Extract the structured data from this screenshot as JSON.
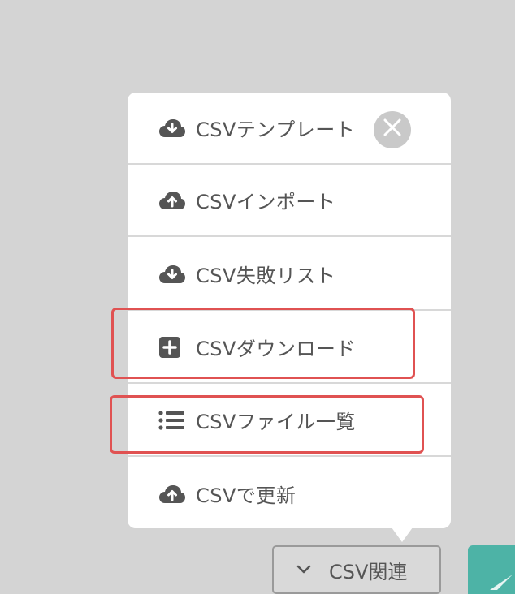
{
  "menu": {
    "items": [
      {
        "label": "CSVテンプレート",
        "icon": "cloud-download-icon"
      },
      {
        "label": "CSVインポート",
        "icon": "cloud-upload-icon"
      },
      {
        "label": "CSV失敗リスト",
        "icon": "cloud-download-icon"
      },
      {
        "label": "CSVダウンロード",
        "icon": "plus-square-icon"
      },
      {
        "label": "CSVファイル一覧",
        "icon": "list-icon"
      },
      {
        "label": "CSVで更新",
        "icon": "cloud-upload-icon"
      }
    ],
    "close_icon": "close-icon"
  },
  "toolbar": {
    "csv_button_label": "CSV関連",
    "csv_button_icon": "chevron-down-icon",
    "submit_icon": "paper-plane-icon"
  },
  "colors": {
    "background": "#d4d4d4",
    "popup": "#ffffff",
    "text": "#555555",
    "highlight": "#e05252",
    "accent": "#4db3a6"
  }
}
